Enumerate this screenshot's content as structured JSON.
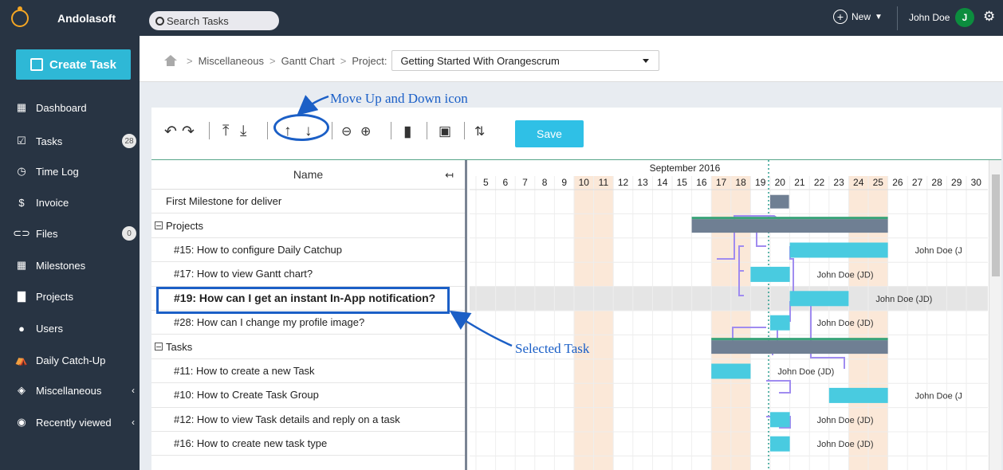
{
  "brand": {
    "name": "Andolasoft"
  },
  "sidebar": {
    "create_label": "Create Task",
    "items": [
      {
        "label": "Dashboard",
        "icon": "dashboard-icon",
        "glyph": "▦"
      },
      {
        "label": "Tasks",
        "icon": "tasks-icon",
        "glyph": "☑",
        "badge": "28"
      },
      {
        "label": "Time Log",
        "icon": "clock-icon",
        "glyph": "◷"
      },
      {
        "label": "Invoice",
        "icon": "invoice-icon",
        "glyph": "$"
      },
      {
        "label": "Files",
        "icon": "link-icon",
        "glyph": "⊂⊃",
        "badge": "0"
      },
      {
        "label": "Milestones",
        "icon": "milestones-icon",
        "glyph": "▦"
      },
      {
        "label": "Projects",
        "icon": "briefcase-icon",
        "glyph": "▇"
      },
      {
        "label": "Users",
        "icon": "user-icon",
        "glyph": "●"
      },
      {
        "label": "Daily Catch-Up",
        "icon": "catchup-icon",
        "glyph": "⛺"
      },
      {
        "label": "Miscellaneous",
        "icon": "layers-icon",
        "glyph": "◈",
        "chevron": "‹"
      },
      {
        "label": "Recently viewed",
        "icon": "eye-icon",
        "glyph": "◉",
        "chevron": "‹"
      }
    ]
  },
  "topbar": {
    "search_placeholder": "Search Tasks",
    "new_label": "New",
    "user_name": "John Doe",
    "avatar_initial": "J"
  },
  "breadcrumb": {
    "items": [
      "Miscellaneous",
      "Gantt Chart"
    ],
    "project_label": "Project:",
    "project_value": "Getting Started With Orangescrum"
  },
  "annotations": {
    "move_icon": "Move Up and Down icon",
    "selected_task": "Selected Task"
  },
  "toolbar": {
    "save_label": "Save"
  },
  "gantt": {
    "name_header": "Name",
    "month_label": "September 2016",
    "days": [
      "5",
      "6",
      "7",
      "8",
      "9",
      "10",
      "11",
      "12",
      "13",
      "14",
      "15",
      "16",
      "17",
      "18",
      "19",
      "20",
      "21",
      "22",
      "23",
      "24",
      "25",
      "26",
      "27",
      "28",
      "29",
      "30"
    ],
    "weekend_days": [
      "10",
      "11",
      "17",
      "18",
      "24",
      "25"
    ],
    "today": "19",
    "rows": [
      {
        "label": "First Milestone for deliver",
        "type": "milestone",
        "indent": 1,
        "bar": {
          "start": 20,
          "end": 21,
          "color": "#6f7f93"
        }
      },
      {
        "label": "Projects",
        "type": "group",
        "indent": 0,
        "bar": {
          "start": 16,
          "end": 26,
          "color": "#6f7f93",
          "topline": "#3aa47a"
        }
      },
      {
        "label": "#15: How to configure Daily Catchup",
        "type": "task",
        "indent": 2,
        "bar": {
          "start": 21,
          "end": 26,
          "color": "#49cbe0"
        },
        "assignee": "John Doe (J"
      },
      {
        "label": "#17: How to view Gantt chart?",
        "type": "task",
        "indent": 2,
        "bar": {
          "start": 19,
          "end": 21,
          "color": "#49cbe0"
        },
        "assignee": "John Doe (JD)"
      },
      {
        "label": "#19: How can I get an instant In-App notification?",
        "type": "task",
        "indent": 2,
        "selected": true,
        "bar": {
          "start": 21,
          "end": 24,
          "color": "#49cbe0"
        },
        "assignee": "John Doe (JD)"
      },
      {
        "label": "#28: How can I change my profile image?",
        "type": "task",
        "indent": 2,
        "bar": {
          "start": 20,
          "end": 21,
          "color": "#49cbe0"
        },
        "assignee": "John Doe (JD)"
      },
      {
        "label": "Tasks",
        "type": "group",
        "indent": 0,
        "bar": {
          "start": 17,
          "end": 26,
          "color": "#6f7f93",
          "topline": "#3aa47a"
        }
      },
      {
        "label": "#11: How to create a new Task",
        "type": "task",
        "indent": 2,
        "bar": {
          "start": 17,
          "end": 19,
          "color": "#49cbe0"
        },
        "assignee": "John Doe (JD)"
      },
      {
        "label": "#10: How to Create Task Group",
        "type": "task",
        "indent": 2,
        "bar": {
          "start": 23,
          "end": 26,
          "color": "#49cbe0"
        },
        "assignee": "John Doe (J"
      },
      {
        "label": "#12: How to view Task details and reply on a task",
        "type": "task",
        "indent": 2,
        "bar": {
          "start": 20,
          "end": 21,
          "color": "#49cbe0"
        },
        "assignee": "John Doe (JD)"
      },
      {
        "label": "#16: How to create new task type",
        "type": "task",
        "indent": 2,
        "bar": {
          "start": 20,
          "end": 21,
          "color": "#49cbe0"
        },
        "assignee": "John Doe (JD)"
      }
    ]
  },
  "colors": {
    "accent": "#2eb8d6",
    "sidebar_bg": "#283443",
    "weekend": "#fbe8d8",
    "annotation": "#1b5fc6",
    "link_line": "#a08cf0"
  }
}
